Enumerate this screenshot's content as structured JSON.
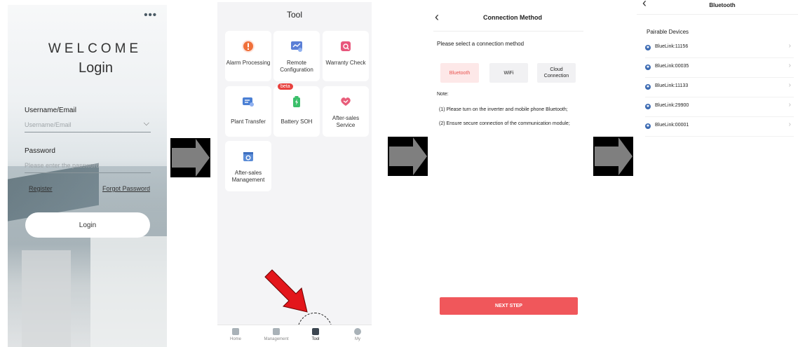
{
  "login_screen": {
    "more_label": "•••",
    "welcome": "WELCOME",
    "title": "Login",
    "username_label": "Username/Email",
    "username_placeholder": "Username/Email",
    "password_label": "Password",
    "password_placeholder": "Please enter the password",
    "register_link": "Register",
    "forgot_link": "Forgot Password",
    "login_button": "Login"
  },
  "tool_screen": {
    "title": "Tool",
    "tiles": [
      {
        "label": "Alarm Processing",
        "icon": "alarm-icon",
        "color": "#f0703a"
      },
      {
        "label": "Remote Configuration",
        "icon": "remote-config-icon",
        "color": "#5b7fd6"
      },
      {
        "label": "Warranty Check",
        "icon": "warranty-icon",
        "color": "#e8567c"
      },
      {
        "label": "Plant Transfer",
        "icon": "plant-transfer-icon",
        "color": "#4a7fd4"
      },
      {
        "label": "Battery SOH",
        "icon": "battery-icon",
        "color": "#3bbf6a",
        "badge": "beta"
      },
      {
        "label": "After-sales Service",
        "icon": "after-sales-service-icon",
        "color": "#e85d7a"
      },
      {
        "label": "After-sales Management",
        "icon": "after-sales-management-icon",
        "color": "#5a8bd6"
      }
    ],
    "tabs": [
      "Home",
      "Management",
      "Tool",
      "My"
    ],
    "active_tab": "Tool"
  },
  "connection_screen": {
    "back_icon": "back-chevron-icon",
    "title": "Connection Method",
    "prompt": "Please select a connection method",
    "options": [
      "Bluetooth",
      "WiFi",
      "Cloud Connection"
    ],
    "selected_option": "Bluetooth",
    "note_label": "Note:",
    "note_line1": "(1) Please turn on the inverter and mobile phone Bluetooth;",
    "note_line2": "(2) Ensure secure connection of the communication module;",
    "next_button": "NEXT STEP"
  },
  "bluetooth_screen": {
    "back_icon": "back-chevron-icon",
    "title": "Bluetooth",
    "subtitle": "Pairable Devices",
    "devices": [
      "BlueLink:11156",
      "BlueLink:00035",
      "BlueLink:11133",
      "BlueLink:29900",
      "BlueLink:00001"
    ]
  },
  "colors": {
    "accent": "#f0575b",
    "arrow": "#7f7f7f",
    "pointer_arrow": "#e3161b"
  }
}
